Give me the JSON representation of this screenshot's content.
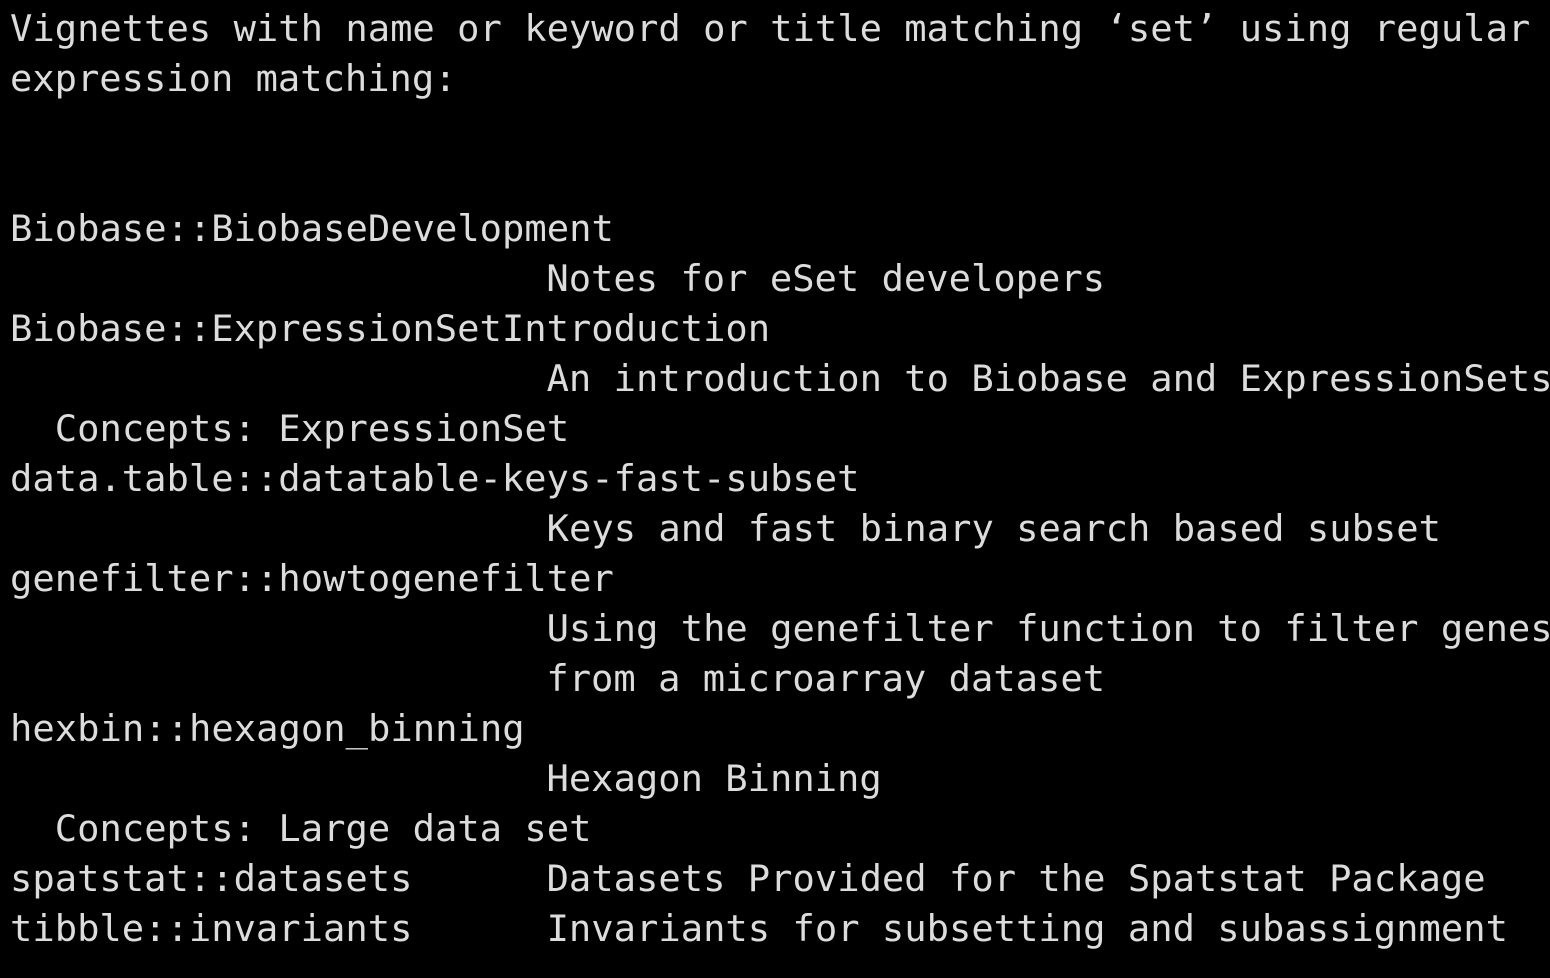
{
  "terminal": {
    "background": "#000000",
    "text_color": "#dcdcdc",
    "header": [
      "Vignettes with name or keyword or title matching ‘set’ using regular",
      "expression matching:"
    ],
    "results": [
      "Biobase::BiobaseDevelopment",
      "                        Notes for eSet developers",
      "Biobase::ExpressionSetIntroduction",
      "                        An introduction to Biobase and ExpressionSets",
      "  Concepts: ExpressionSet",
      "data.table::datatable-keys-fast-subset",
      "                        Keys and fast binary search based subset",
      "genefilter::howtogenefilter",
      "                        Using the genefilter function to filter genes",
      "                        from a microarray dataset",
      "hexbin::hexagon_binning",
      "                        Hexagon Binning",
      "  Concepts: Large data set",
      "spatstat::datasets      Datasets Provided for the Spatstat Package",
      "tibble::invariants      Invariants for subsetting and subassignment"
    ]
  }
}
